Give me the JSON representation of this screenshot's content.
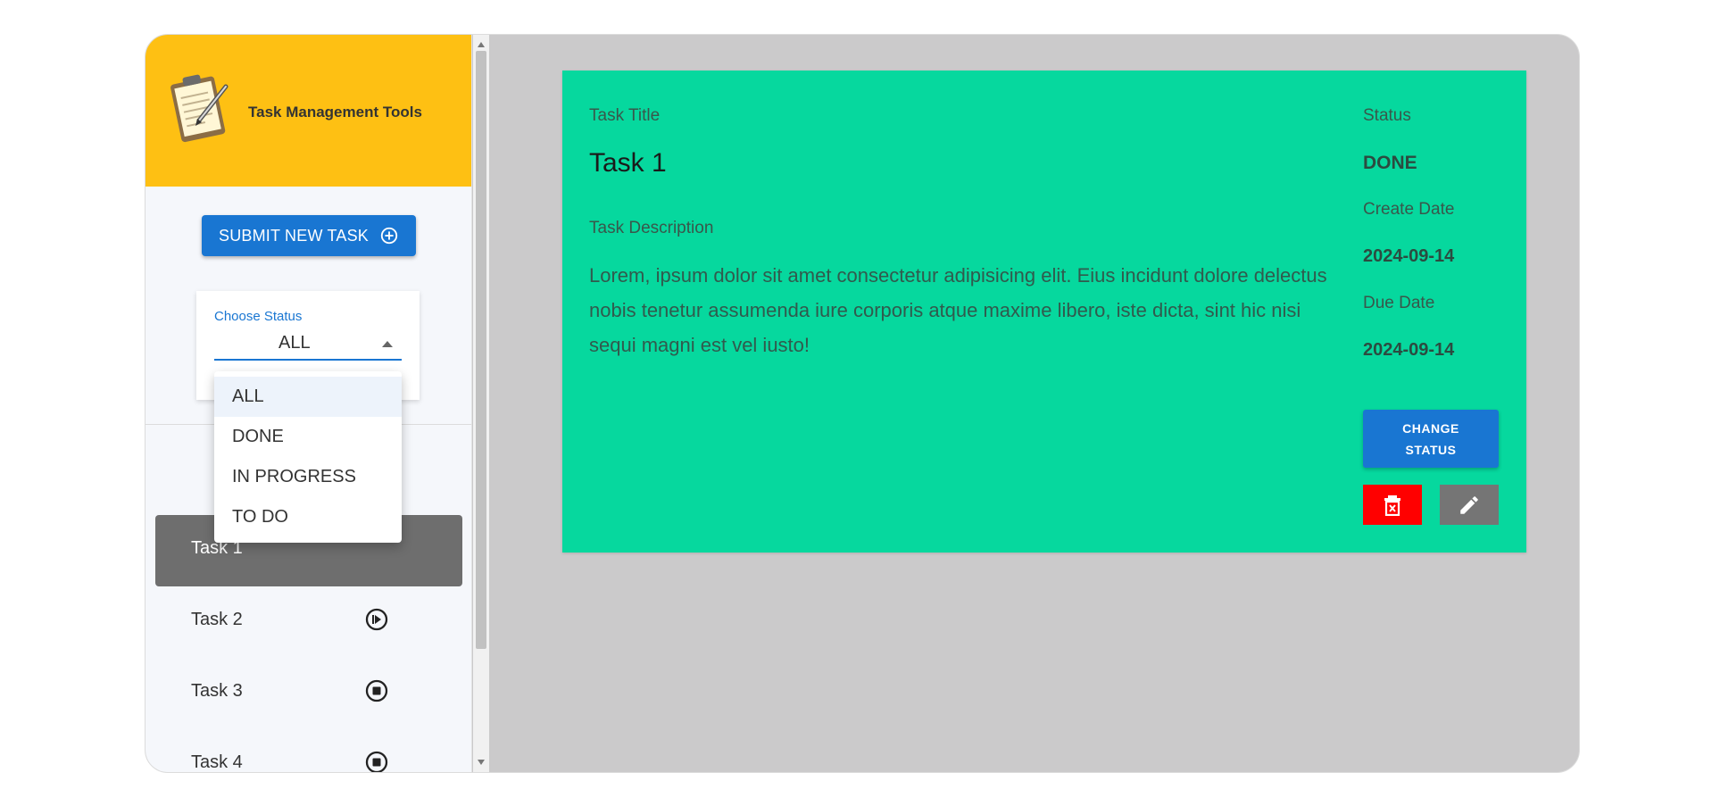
{
  "app": {
    "brand": {
      "title": "Task Management Tools",
      "logo_icon": "clipboard-pencil-icon"
    },
    "sidebar": {
      "submit_button": {
        "label": "SUBMIT NEW TASK",
        "icon": "plus-circle-icon"
      },
      "status_filter": {
        "label": "Choose Status",
        "selected": "ALL",
        "options": [
          "ALL",
          "DONE",
          "IN PROGRESS",
          "TO DO"
        ]
      },
      "tasks": [
        {
          "label": "Task 1",
          "active": true
        },
        {
          "label": "Task 2",
          "icon": "play-circle-icon"
        },
        {
          "label": "Task 3",
          "icon": "stop-circle-icon"
        },
        {
          "label": "Task 4",
          "icon": "stop-circle-icon"
        }
      ]
    },
    "detail": {
      "task_title_label": "Task Title",
      "task_title": "Task 1",
      "description_label": "Task Description",
      "description": "Lorem, ipsum dolor sit amet consectetur adipisicing elit. Eius incidunt dolore delectus nobis tenetur assumenda iure corporis atque maxime libero, iste dicta, sint hic nisi sequi magni est vel iusto!",
      "status_label": "Status",
      "status": "DONE",
      "create_date_label": "Create Date",
      "create_date": "2024-09-14",
      "due_date_label": "Due Date",
      "due_date": "2024-09-14",
      "change_status_label": "CHANGE STATUS",
      "delete_icon": "trash-x-icon",
      "edit_icon": "pencil-icon"
    },
    "colors": {
      "header": "#fec013",
      "primary": "#1976d2",
      "card": "#06d89e",
      "danger": "#ff0000",
      "active_task": "#6e6e6e"
    }
  }
}
